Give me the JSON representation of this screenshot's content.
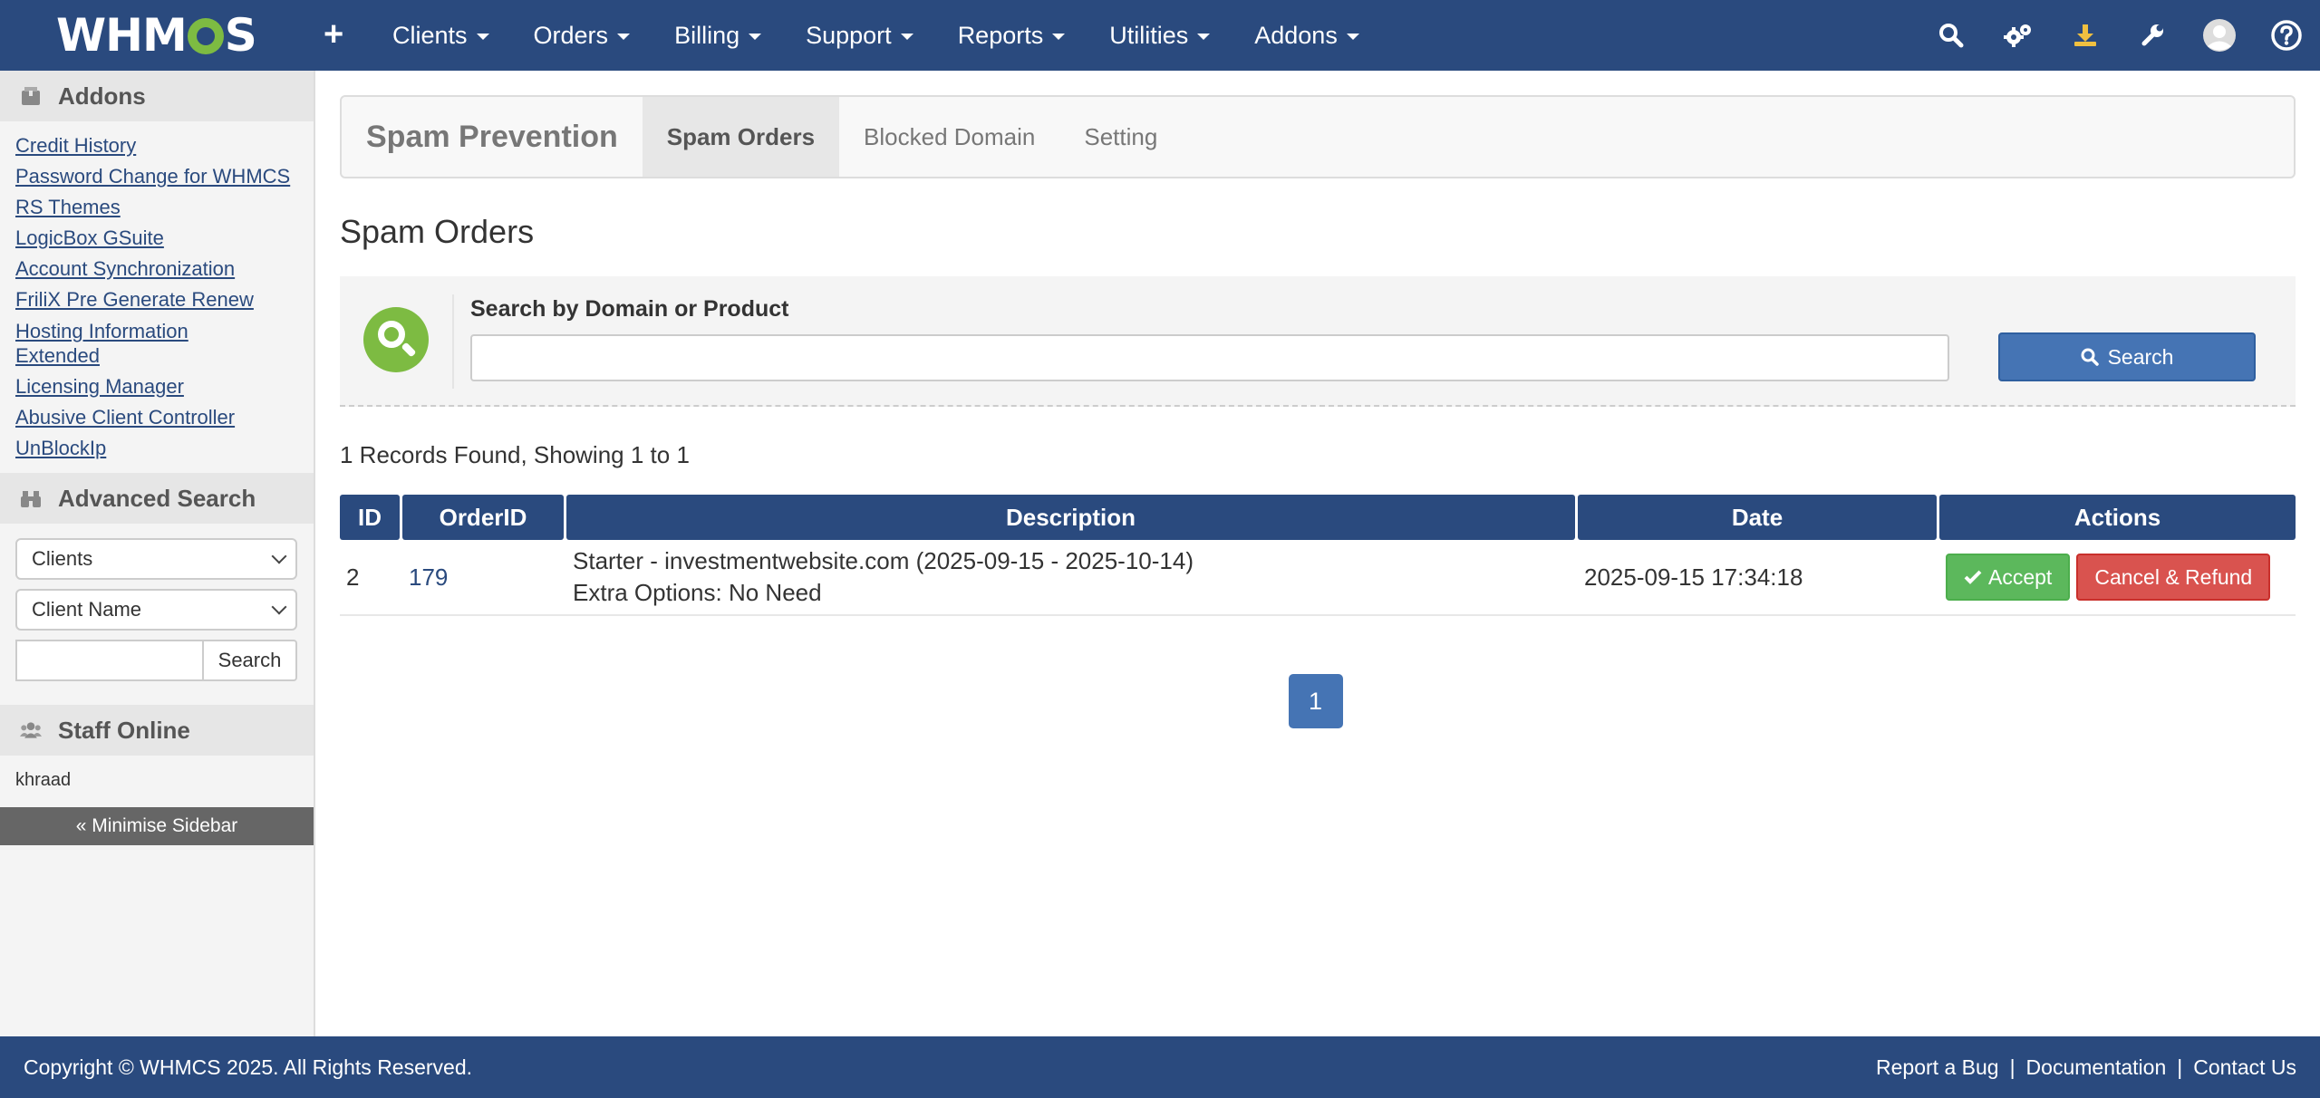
{
  "brand": {
    "logo_left": "WHM",
    "logo_right": "S"
  },
  "nav": {
    "add_label": "+",
    "items": [
      {
        "label": "Clients"
      },
      {
        "label": "Orders"
      },
      {
        "label": "Billing"
      },
      {
        "label": "Support"
      },
      {
        "label": "Reports"
      },
      {
        "label": "Utilities"
      },
      {
        "label": "Addons"
      }
    ],
    "icons": [
      "search-icon",
      "cogs-icon",
      "download-icon",
      "wrench-icon",
      "avatar-icon",
      "help-icon"
    ]
  },
  "sidebar": {
    "addons_title": "Addons",
    "addon_links": [
      "Credit History",
      "Password Change for WHMCS",
      "RS Themes",
      "LogicBox GSuite",
      "Account Synchronization",
      "FriliX Pre Generate Renew",
      "Hosting Information",
      "Extended",
      "Licensing Manager",
      "Abusive Client Controller",
      "UnBlockIp"
    ],
    "advanced_search_title": "Advanced Search",
    "select_type": "Clients",
    "select_field": "Client Name",
    "search_value": "",
    "search_button": "Search",
    "staff_title": "Staff Online",
    "staff_name": "khraad",
    "minimise_label": "« Minimise Sidebar"
  },
  "tabs": {
    "brand": "Spam Prevention",
    "items": [
      "Spam Orders",
      "Blocked Domain",
      "Setting"
    ],
    "active": "Spam Orders"
  },
  "page": {
    "title": "Spam Orders",
    "search_label": "Search by Domain or Product",
    "search_value": "",
    "search_button": "Search",
    "records_text": "1 Records Found, Showing 1 to 1"
  },
  "table": {
    "columns": [
      "ID",
      "OrderID",
      "Description",
      "Date",
      "Actions"
    ],
    "rows": [
      {
        "id": "2",
        "order_id": "179",
        "description_line1": "Starter - investmentwebsite.com (2025-09-15 - 2025-10-14)",
        "description_line2": "Extra Options: No Need",
        "date": "2025-09-15 17:34:18",
        "accept_label": "Accept",
        "cancel_label": "Cancel & Refund"
      }
    ]
  },
  "pagination": {
    "current": "1"
  },
  "footer": {
    "copyright": "Copyright © WHMCS 2025. All Rights Reserved.",
    "links": [
      "Report a Bug",
      "Documentation",
      "Contact Us"
    ]
  },
  "colors": {
    "nav_bg": "#2a4a7e",
    "brand_green": "#7dbb42",
    "primary_button": "#4574b4",
    "accept_green": "#5cb85c",
    "cancel_red": "#d9534f"
  }
}
